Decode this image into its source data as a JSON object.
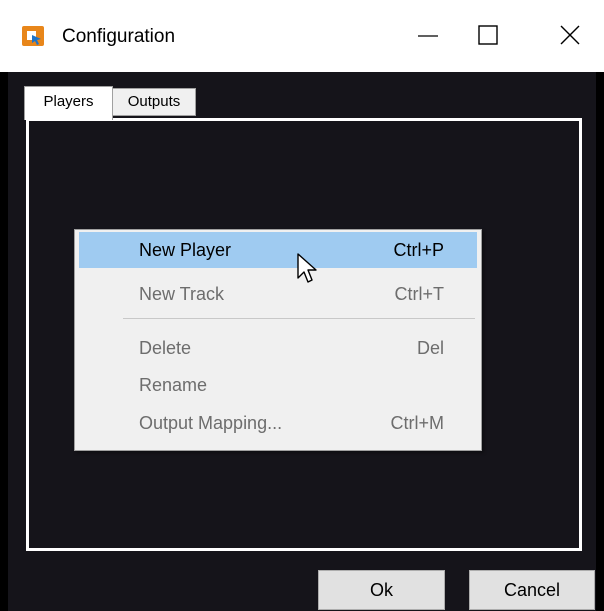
{
  "window": {
    "title": "Configuration",
    "app_icon": "app-icon",
    "controls": [
      "minimize-icon",
      "maximize-icon",
      "close-icon"
    ]
  },
  "tabs": [
    {
      "label": "Players",
      "selected": true
    },
    {
      "label": "Outputs",
      "selected": false
    }
  ],
  "context_menu": {
    "items": [
      {
        "label": "New Player",
        "shortcut": "Ctrl+P",
        "enabled": true,
        "highlighted": true
      },
      {
        "label": "New Track",
        "shortcut": "Ctrl+T",
        "enabled": false
      },
      {
        "label": "Delete",
        "shortcut": "Del",
        "enabled": false
      },
      {
        "label": "Rename",
        "shortcut": "",
        "enabled": false
      },
      {
        "label": "Output Mapping...",
        "shortcut": "Ctrl+M",
        "enabled": false
      }
    ]
  },
  "buttons": {
    "ok_label": "Ok",
    "cancel_label": "Cancel"
  },
  "colors": {
    "background": "#15141a",
    "menu_highlight": "#9fcbf1",
    "menu_disabled_text": "#6d6d6d",
    "app_icon_orange": "#e8861a",
    "app_icon_blue": "#1e73c8"
  }
}
